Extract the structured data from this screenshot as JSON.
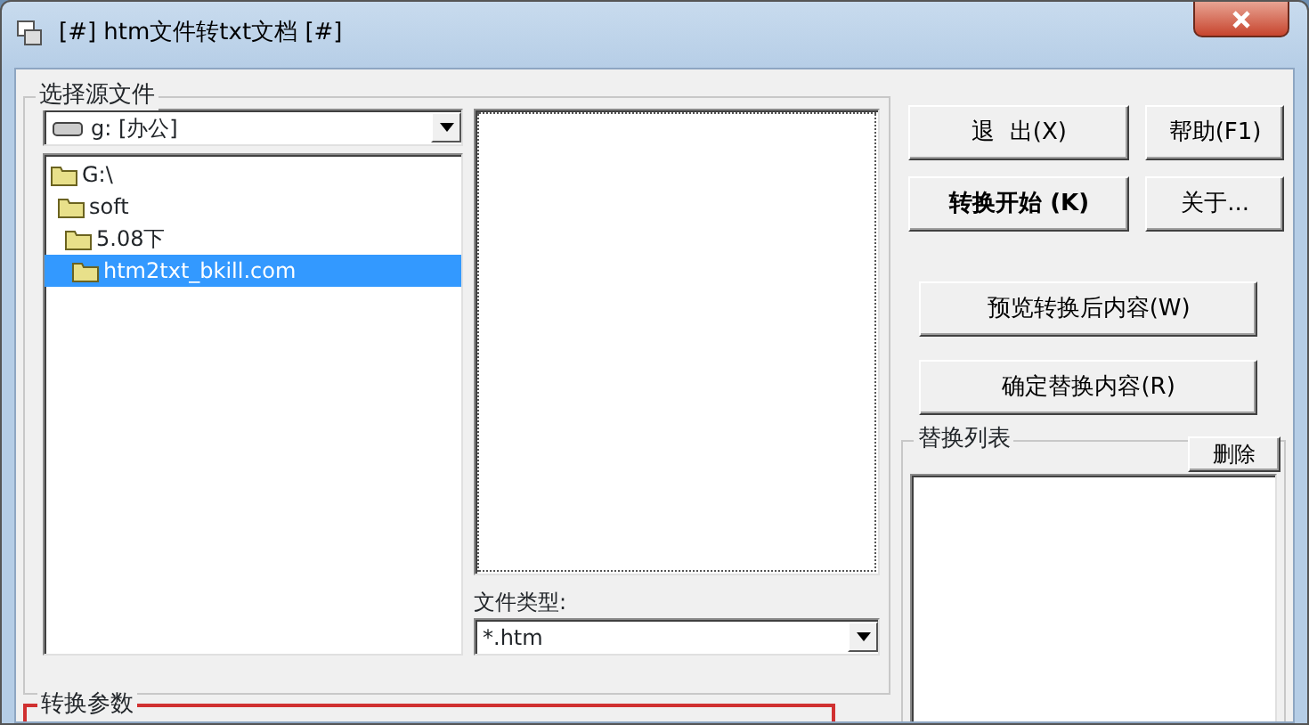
{
  "window": {
    "title": "[#] htm文件转txt文档 [#]"
  },
  "source_group": {
    "label": "选择源文件",
    "drive": "g: [办公]",
    "folders": [
      {
        "name": "G:\\",
        "selected": false,
        "children": [
          {
            "name": "soft",
            "selected": false,
            "children": [
              {
                "name": "5.08下",
                "selected": false,
                "children": [
                  {
                    "name": "htm2txt_bkill.com",
                    "selected": true
                  }
                ]
              }
            ]
          }
        ]
      }
    ],
    "file_type_label": "文件类型:",
    "file_type": "*.htm"
  },
  "top_buttons": [
    {
      "label": "退  出(X)",
      "bold": false
    },
    {
      "label": "帮助(F1)",
      "bold": false
    },
    {
      "label": "转换开始 (K)",
      "bold": true
    },
    {
      "label": "关于...",
      "bold": false
    }
  ],
  "wide_buttons": [
    "预览转换后内容(W)",
    "确定替换内容(R)"
  ],
  "replace_list": {
    "label": "替换列表",
    "delete_button": "删除"
  },
  "params_group": {
    "label": "转换参数",
    "highlighted": true
  }
}
